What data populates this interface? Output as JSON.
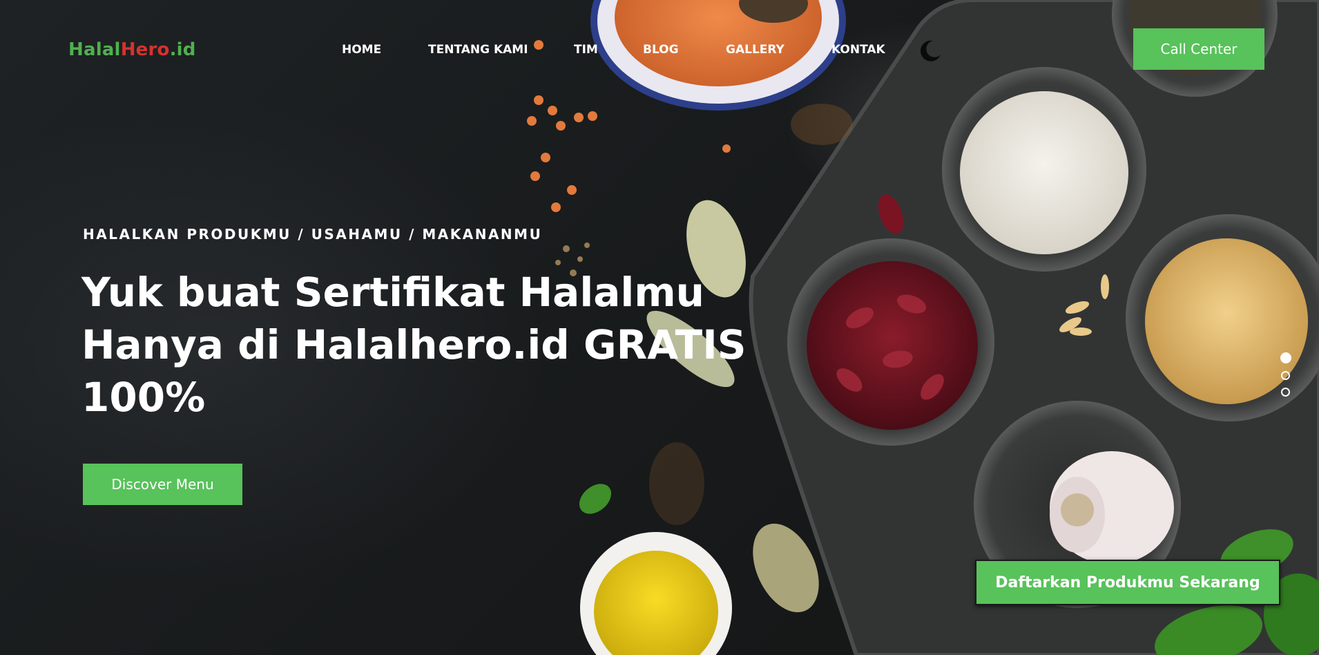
{
  "brand": {
    "part1": "Halal",
    "part2": "Hero",
    "part3": ".id"
  },
  "nav": {
    "items": [
      "HOME",
      "TENTANG KAMI",
      "TIM",
      "BLOG",
      "GALLERY",
      "KONTAK"
    ]
  },
  "header": {
    "call_center_label": "Call Center",
    "theme_icon": "moon-icon"
  },
  "hero": {
    "kicker": "HALALKAN PRODUKMU / USAHAMU / MAKANANMU",
    "headline_lines": [
      "Yuk buat Sertifikat Halalmu",
      "Hanya di Halalhero.id GRATIS",
      "100%"
    ],
    "cta_label": "Discover Menu",
    "register_label": "Daftarkan Produkmu Sekarang"
  },
  "slider": {
    "slide_count": 3,
    "active_index": 0
  },
  "colors": {
    "accent": "#58c25b",
    "brand_green": "#4fb14f",
    "brand_red": "#d6322e",
    "text": "#ffffff"
  }
}
